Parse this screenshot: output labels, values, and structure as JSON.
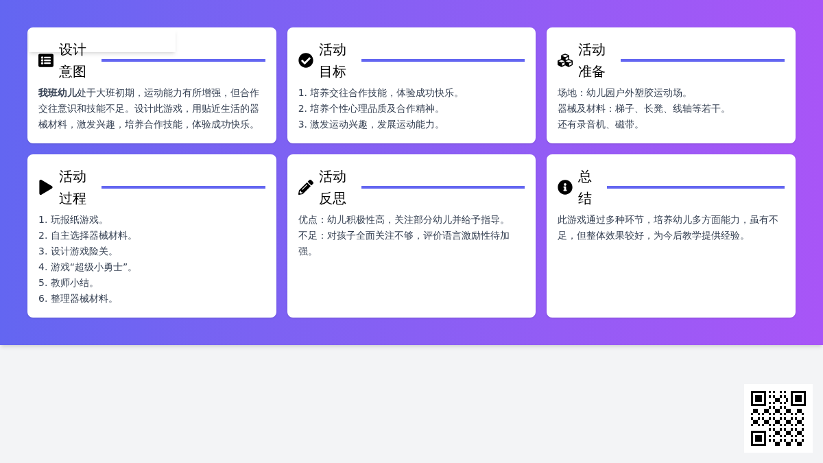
{
  "cards": [
    {
      "kind": "list",
      "title": "设计意图",
      "covered": true,
      "lines": [
        "**我班幼儿**处于大班初期，运动能力有所增强，但合作交往意识和技能不足。设计此游戏，用贴近生活的器械材料，激发兴趣，培养合作技能，体验成功快乐。"
      ]
    },
    {
      "kind": "check",
      "title": "活动目标",
      "covered": false,
      "lines": [
        "1. 培养交往合作技能，体验成功快乐。",
        "2. 培养个性心理品质及合作精神。",
        "3. 激发运动兴趣，发展运动能力。"
      ]
    },
    {
      "kind": "cubes",
      "title": "活动准备",
      "covered": false,
      "lines": [
        "场地：幼儿园户外塑胶运动场。",
        "器械及材料：梯子、长凳、线轴等若干。",
        "还有录音机、磁带。"
      ]
    },
    {
      "kind": "play",
      "title": "活动过程",
      "covered": false,
      "lines": [
        "1. 玩报纸游戏。",
        "2. 自主选择器械材料。",
        "3. 设计游戏险关。",
        "4. 游戏“超级小勇士”。",
        "5. 教师小结。",
        "6. 整理器械材料。"
      ]
    },
    {
      "kind": "pencil",
      "title": "活动反思",
      "covered": false,
      "lines": [
        "优点：幼儿积极性高，关注部分幼儿并给予指导。",
        "不足：对孩子全面关注不够，评价语言激励性待加强。"
      ]
    },
    {
      "kind": "info",
      "title": "总结",
      "covered": false,
      "lines": [
        "此游戏通过多种环节，培养幼儿多方面能力，虽有不足，但整体效果较好，为今后教学提供经验。"
      ]
    }
  ]
}
